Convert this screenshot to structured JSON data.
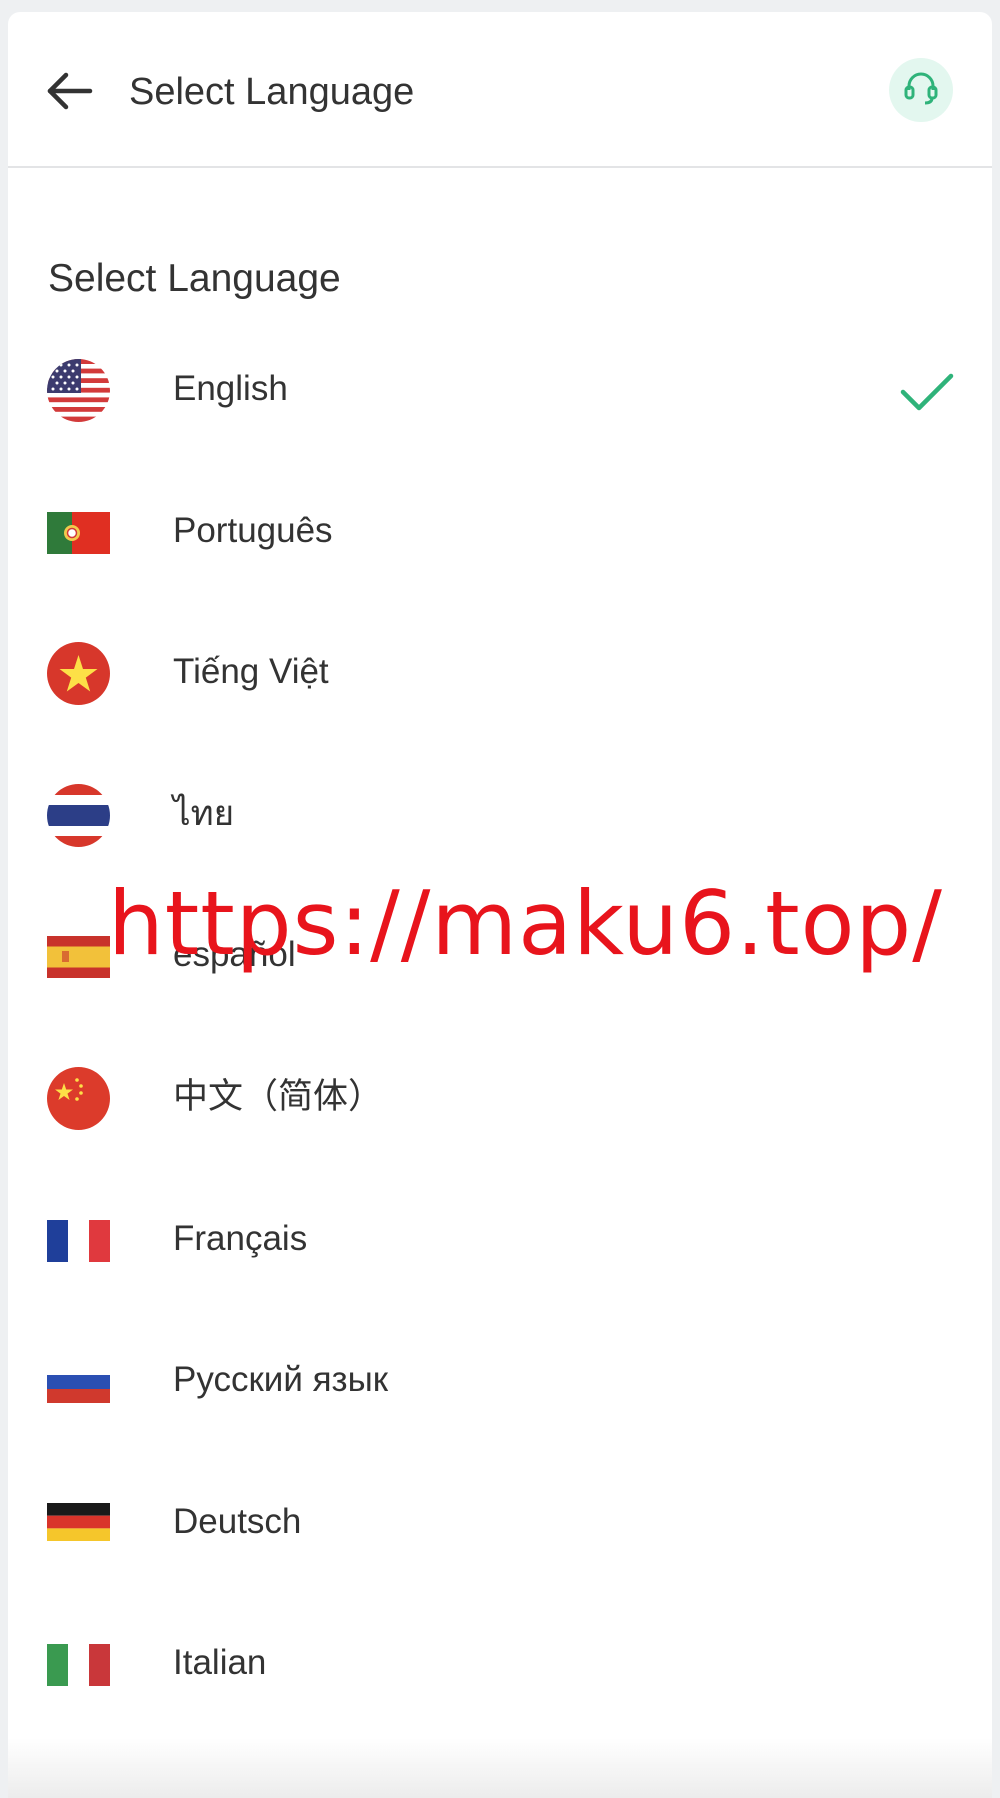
{
  "header": {
    "title": "Select Language",
    "back_icon": "arrow-left-icon",
    "support_icon": "headset-icon",
    "accent_color": "#2fb37a"
  },
  "section": {
    "title": "Select Language"
  },
  "languages": [
    {
      "label": "English",
      "flag": "us-flag",
      "selected": true
    },
    {
      "label": "Português",
      "flag": "portugal-flag",
      "selected": false
    },
    {
      "label": "Tiếng Việt",
      "flag": "vietnam-flag",
      "selected": false
    },
    {
      "label": "ไทย",
      "flag": "thailand-flag",
      "selected": false
    },
    {
      "label": "español",
      "flag": "spain-flag",
      "selected": false
    },
    {
      "label": "中文（简体）",
      "flag": "china-flag",
      "selected": false
    },
    {
      "label": "Français",
      "flag": "france-flag",
      "selected": false
    },
    {
      "label": "Русский язык",
      "flag": "russia-flag",
      "selected": false
    },
    {
      "label": "Deutsch",
      "flag": "germany-flag",
      "selected": false
    },
    {
      "label": "Italian",
      "flag": "italy-flag",
      "selected": false
    }
  ],
  "watermark": {
    "text": "https://maku6.top/",
    "color": "#e8141c"
  }
}
